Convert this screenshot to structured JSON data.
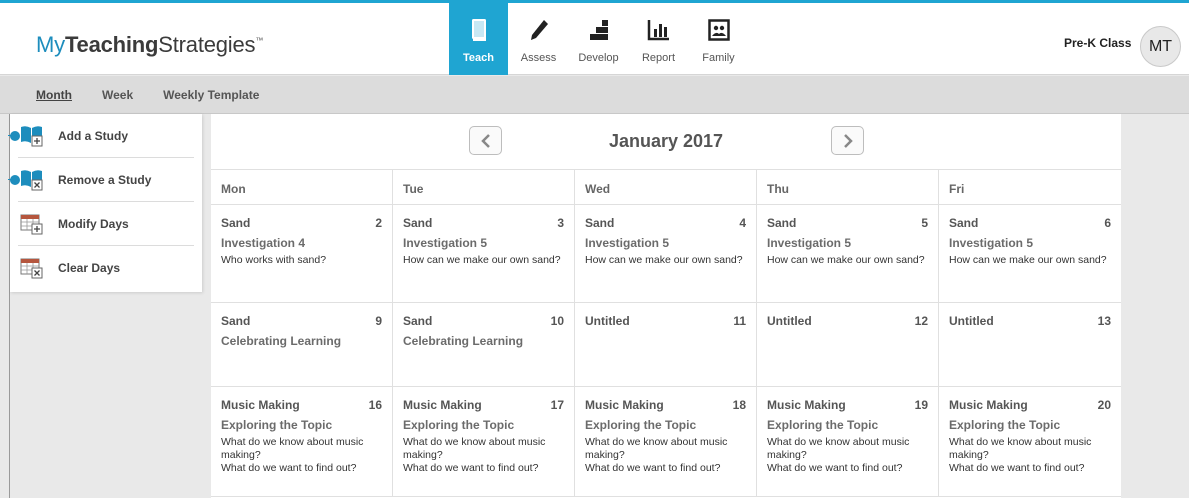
{
  "header": {
    "logo_my": "My",
    "logo_teaching": "Teaching",
    "logo_strategies": "Strategies",
    "logo_tm": "™",
    "class_name": "Pre-K Class",
    "avatar_initials": "MT"
  },
  "nav": {
    "teach": "Teach",
    "assess": "Assess",
    "develop": "Develop",
    "report": "Report",
    "family": "Family"
  },
  "subnav": {
    "month": "Month",
    "week": "Week",
    "weekly_template": "Weekly Template"
  },
  "side": {
    "add_study": "Add a Study",
    "remove_study": "Remove a Study",
    "modify_days": "Modify Days",
    "clear_days": "Clear Days"
  },
  "calendar": {
    "month_title": "January 2017",
    "day_headers": [
      "Mon",
      "Tue",
      "Wed",
      "Thu",
      "Fri"
    ],
    "weeks": [
      [
        {
          "study": "Sand",
          "num": "2",
          "phase": "Investigation 4",
          "q1": "Who works with sand?",
          "q2": ""
        },
        {
          "study": "Sand",
          "num": "3",
          "phase": "Investigation 5",
          "q1": "How can we make our own sand?",
          "q2": ""
        },
        {
          "study": "Sand",
          "num": "4",
          "phase": "Investigation 5",
          "q1": "How can we make our own sand?",
          "q2": ""
        },
        {
          "study": "Sand",
          "num": "5",
          "phase": "Investigation 5",
          "q1": "How can we make our own sand?",
          "q2": ""
        },
        {
          "study": "Sand",
          "num": "6",
          "phase": "Investigation 5",
          "q1": "How can we make our own sand?",
          "q2": ""
        }
      ],
      [
        {
          "study": "Sand",
          "num": "9",
          "phase": "Celebrating Learning",
          "q1": "",
          "q2": ""
        },
        {
          "study": "Sand",
          "num": "10",
          "phase": "Celebrating Learning",
          "q1": "",
          "q2": ""
        },
        {
          "study": "Untitled",
          "num": "11",
          "phase": "",
          "q1": "",
          "q2": ""
        },
        {
          "study": "Untitled",
          "num": "12",
          "phase": "",
          "q1": "",
          "q2": ""
        },
        {
          "study": "Untitled",
          "num": "13",
          "phase": "",
          "q1": "",
          "q2": ""
        }
      ],
      [
        {
          "study": "Music Making",
          "num": "16",
          "phase": "Exploring the Topic",
          "q1": "What do we know about music making?",
          "q2": "What do we want to find out?"
        },
        {
          "study": "Music Making",
          "num": "17",
          "phase": "Exploring the Topic",
          "q1": "What do we know about music making?",
          "q2": "What do we want to find out?"
        },
        {
          "study": "Music Making",
          "num": "18",
          "phase": "Exploring the Topic",
          "q1": "What do we know about music making?",
          "q2": "What do we want to find out?"
        },
        {
          "study": "Music Making",
          "num": "19",
          "phase": "Exploring the Topic",
          "q1": "What do we know about music making?",
          "q2": "What do we want to find out?"
        },
        {
          "study": "Music Making",
          "num": "20",
          "phase": "Exploring the Topic",
          "q1": "What do we know about music making?",
          "q2": "What do we want to find out?"
        }
      ]
    ]
  },
  "colors": {
    "accent": "#1fa5d2",
    "brand_blue": "#1d8dbd"
  }
}
